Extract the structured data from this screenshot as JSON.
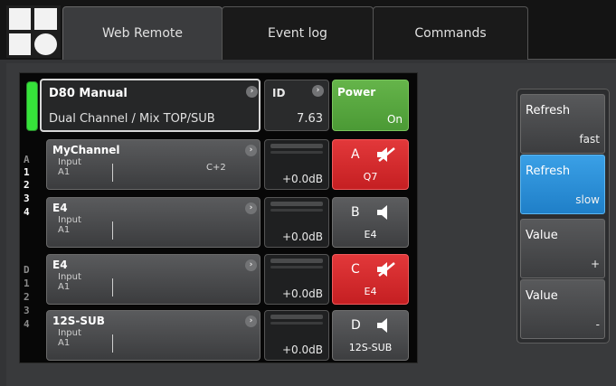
{
  "tabs": [
    {
      "label": "Web Remote",
      "active": true
    },
    {
      "label": "Event log",
      "active": false
    },
    {
      "label": "Commands",
      "active": false
    }
  ],
  "device": {
    "name": "D80 Manual",
    "mode": "Dual Channel / Mix TOP/SUB",
    "id_label": "ID",
    "id_value": "7.63",
    "power_label": "Power",
    "power_state": "On",
    "status_color": "#36e23a"
  },
  "side_labels": {
    "group_a": [
      "A",
      "1",
      "2",
      "3",
      "4"
    ],
    "group_d": [
      "D",
      "1",
      "2",
      "3",
      "4"
    ]
  },
  "channels": [
    {
      "name": "MyChannel",
      "input": "Input",
      "input_ch": "A1",
      "delay": "C+2",
      "gain": "+0.0dB",
      "out_letter": "A",
      "out_label": "Q7",
      "muted": true
    },
    {
      "name": "E4",
      "input": "Input",
      "input_ch": "A1",
      "delay": "",
      "gain": "+0.0dB",
      "out_letter": "B",
      "out_label": "E4",
      "muted": false
    },
    {
      "name": "E4",
      "input": "Input",
      "input_ch": "A1",
      "delay": "",
      "gain": "+0.0dB",
      "out_letter": "C",
      "out_label": "E4",
      "muted": true
    },
    {
      "name": "12S-SUB",
      "input": "Input",
      "input_ch": "A1",
      "delay": "",
      "gain": "+0.0dB",
      "out_letter": "D",
      "out_label": "12S-SUB",
      "muted": false
    }
  ],
  "controls": {
    "refresh_fast": {
      "top": "Refresh",
      "bottom": "fast"
    },
    "refresh_slow": {
      "top": "Refresh",
      "bottom": "slow",
      "active": true
    },
    "value_plus": {
      "top": "Value",
      "bottom": "+"
    },
    "value_minus": {
      "top": "Value",
      "bottom": "-"
    }
  },
  "colors": {
    "accent_blue": "#2a90d8",
    "mute_red": "#d52a2c",
    "power_green": "#5aa83f"
  }
}
